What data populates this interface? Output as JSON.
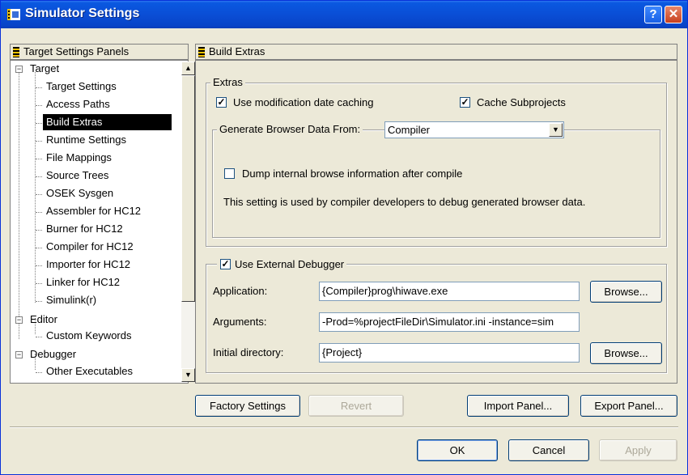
{
  "window": {
    "title": "Simulator Settings"
  },
  "tree": {
    "header": "Target Settings Panels",
    "items": [
      {
        "label": "Target",
        "level": 0,
        "expander": "−"
      },
      {
        "label": "Target Settings",
        "level": 1
      },
      {
        "label": "Access Paths",
        "level": 1
      },
      {
        "label": "Build Extras",
        "level": 1,
        "selected": true
      },
      {
        "label": "Runtime Settings",
        "level": 1
      },
      {
        "label": "File Mappings",
        "level": 1
      },
      {
        "label": "Source Trees",
        "level": 1
      },
      {
        "label": "OSEK Sysgen",
        "level": 1
      },
      {
        "label": "Assembler for HC12",
        "level": 1
      },
      {
        "label": "Burner for HC12",
        "level": 1
      },
      {
        "label": "Compiler for HC12",
        "level": 1
      },
      {
        "label": "Importer for HC12",
        "level": 1
      },
      {
        "label": "Linker for HC12",
        "level": 1
      },
      {
        "label": "Simulink(r)",
        "level": 1
      },
      {
        "label": "Editor",
        "level": 0,
        "expander": "−"
      },
      {
        "label": "Custom Keywords",
        "level": 1
      },
      {
        "label": "Debugger",
        "level": 0,
        "expander": "−"
      },
      {
        "label": "Other Executables",
        "level": 1
      }
    ]
  },
  "panel": {
    "header": "Build Extras",
    "extras": {
      "legend": "Extras",
      "mod_date_caching": {
        "label": "Use modification date caching",
        "checked": true
      },
      "cache_subprojects": {
        "label": "Cache Subprojects",
        "checked": true
      },
      "browser": {
        "legend": "Generate Browser Data From:",
        "selected": "Compiler",
        "dump_checkbox": {
          "label": "Dump internal browse information after compile",
          "checked": false
        },
        "note": "This setting is used by compiler developers to debug generated browser data."
      }
    },
    "external_debugger": {
      "legend": "Use External Debugger",
      "checked": true,
      "application_label": "Application:",
      "application_value": "{Compiler}prog\\hiwave.exe",
      "arguments_label": "Arguments:",
      "arguments_value": "-Prod=%projectFileDir\\Simulator.ini -instance=sim",
      "initdir_label": "Initial directory:",
      "initdir_value": "{Project}",
      "browse_label": "Browse..."
    }
  },
  "panel_buttons": {
    "factory": "Factory Settings",
    "revert": "Revert",
    "import": "Import Panel...",
    "export": "Export Panel..."
  },
  "dialog_buttons": {
    "ok": "OK",
    "cancel": "Cancel",
    "apply": "Apply"
  }
}
